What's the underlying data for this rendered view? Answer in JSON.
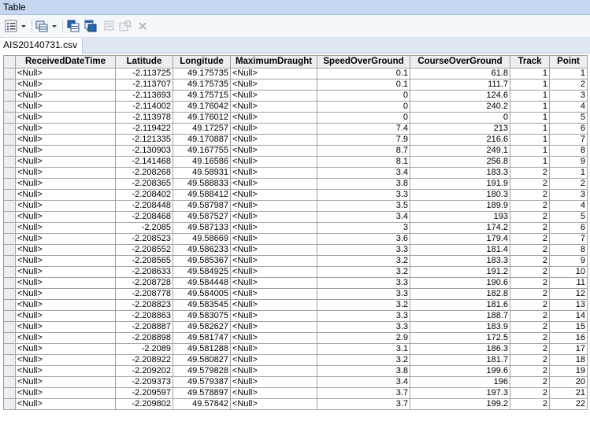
{
  "window": {
    "title": "Table"
  },
  "toolbar": {
    "buttons": [
      {
        "name": "table-options-icon",
        "dropdown": true
      },
      {
        "name": "related-tables-icon",
        "dropdown": true
      },
      {
        "name": "select-by-attributes-icon"
      },
      {
        "name": "switch-selection-icon"
      },
      {
        "name": "clear-selection-icon"
      },
      {
        "name": "zoom-to-selected-icon"
      },
      {
        "name": "delete-selected-icon"
      }
    ]
  },
  "tab": {
    "label": "AIS20140731.csv"
  },
  "table": {
    "columns": [
      "ReceivedDateTime",
      "Latitude",
      "Longitude",
      "MaximumDraught",
      "SpeedOverGround",
      "CourseOverGround",
      "Track",
      "Point"
    ],
    "rows": [
      [
        "<Null>",
        "-2.113725",
        "49.175735",
        "<Null>",
        "0.1",
        "61.8",
        "1",
        "1"
      ],
      [
        "<Null>",
        "-2.113707",
        "49.175735",
        "<Null>",
        "0.1",
        "111.7",
        "1",
        "2"
      ],
      [
        "<Null>",
        "-2.113693",
        "49.175715",
        "<Null>",
        "0",
        "124.6",
        "1",
        "3"
      ],
      [
        "<Null>",
        "-2.114002",
        "49.176042",
        "<Null>",
        "0",
        "240.2",
        "1",
        "4"
      ],
      [
        "<Null>",
        "-2.113978",
        "49.176012",
        "<Null>",
        "0",
        "0",
        "1",
        "5"
      ],
      [
        "<Null>",
        "-2.119422",
        "49.17257",
        "<Null>",
        "7.4",
        "213",
        "1",
        "6"
      ],
      [
        "<Null>",
        "-2.121335",
        "49.170887",
        "<Null>",
        "7.9",
        "216.6",
        "1",
        "7"
      ],
      [
        "<Null>",
        "-2.130903",
        "49.167755",
        "<Null>",
        "8.7",
        "249.1",
        "1",
        "8"
      ],
      [
        "<Null>",
        "-2.141468",
        "49.16586",
        "<Null>",
        "8.1",
        "256.8",
        "1",
        "9"
      ],
      [
        "<Null>",
        "-2.208268",
        "49.58931",
        "<Null>",
        "3.4",
        "183.3",
        "2",
        "1"
      ],
      [
        "<Null>",
        "-2.208365",
        "49.588833",
        "<Null>",
        "3.8",
        "191.9",
        "2",
        "2"
      ],
      [
        "<Null>",
        "-2.208402",
        "49.588412",
        "<Null>",
        "3.3",
        "180.3",
        "2",
        "3"
      ],
      [
        "<Null>",
        "-2.208448",
        "49.587987",
        "<Null>",
        "3.5",
        "189.9",
        "2",
        "4"
      ],
      [
        "<Null>",
        "-2.208468",
        "49.587527",
        "<Null>",
        "3.4",
        "193",
        "2",
        "5"
      ],
      [
        "<Null>",
        "-2.2085",
        "49.587133",
        "<Null>",
        "3",
        "174.2",
        "2",
        "6"
      ],
      [
        "<Null>",
        "-2.208523",
        "49.58669",
        "<Null>",
        "3.6",
        "179.4",
        "2",
        "7"
      ],
      [
        "<Null>",
        "-2.208552",
        "49.586233",
        "<Null>",
        "3.3",
        "181.4",
        "2",
        "8"
      ],
      [
        "<Null>",
        "-2.208565",
        "49.585367",
        "<Null>",
        "3.2",
        "183.3",
        "2",
        "9"
      ],
      [
        "<Null>",
        "-2.208633",
        "49.584925",
        "<Null>",
        "3.2",
        "191.2",
        "2",
        "10"
      ],
      [
        "<Null>",
        "-2.208728",
        "49.584448",
        "<Null>",
        "3.3",
        "190.6",
        "2",
        "11"
      ],
      [
        "<Null>",
        "-2.208778",
        "49.584005",
        "<Null>",
        "3.3",
        "182.8",
        "2",
        "12"
      ],
      [
        "<Null>",
        "-2.208823",
        "49.583545",
        "<Null>",
        "3.2",
        "181.6",
        "2",
        "13"
      ],
      [
        "<Null>",
        "-2.208863",
        "49.583075",
        "<Null>",
        "3.3",
        "188.7",
        "2",
        "14"
      ],
      [
        "<Null>",
        "-2.208887",
        "49.582627",
        "<Null>",
        "3.3",
        "183.9",
        "2",
        "15"
      ],
      [
        "<Null>",
        "-2.208898",
        "49.581747",
        "<Null>",
        "2.9",
        "172.5",
        "2",
        "16"
      ],
      [
        "<Null>",
        "-2.2089",
        "49.581288",
        "<Null>",
        "3.1",
        "186.3",
        "2",
        "17"
      ],
      [
        "<Null>",
        "-2.208922",
        "49.580827",
        "<Null>",
        "3.2",
        "181.7",
        "2",
        "18"
      ],
      [
        "<Null>",
        "-2.209202",
        "49.579828",
        "<Null>",
        "3.8",
        "199.6",
        "2",
        "19"
      ],
      [
        "<Null>",
        "-2.209373",
        "49.579387",
        "<Null>",
        "3.4",
        "196",
        "2",
        "20"
      ],
      [
        "<Null>",
        "-2.209597",
        "49.578897",
        "<Null>",
        "3.7",
        "197.3",
        "2",
        "21"
      ],
      [
        "<Null>",
        "-2.209802",
        "49.57842",
        "<Null>",
        "3.7",
        "199.2",
        "2",
        "22"
      ]
    ]
  }
}
